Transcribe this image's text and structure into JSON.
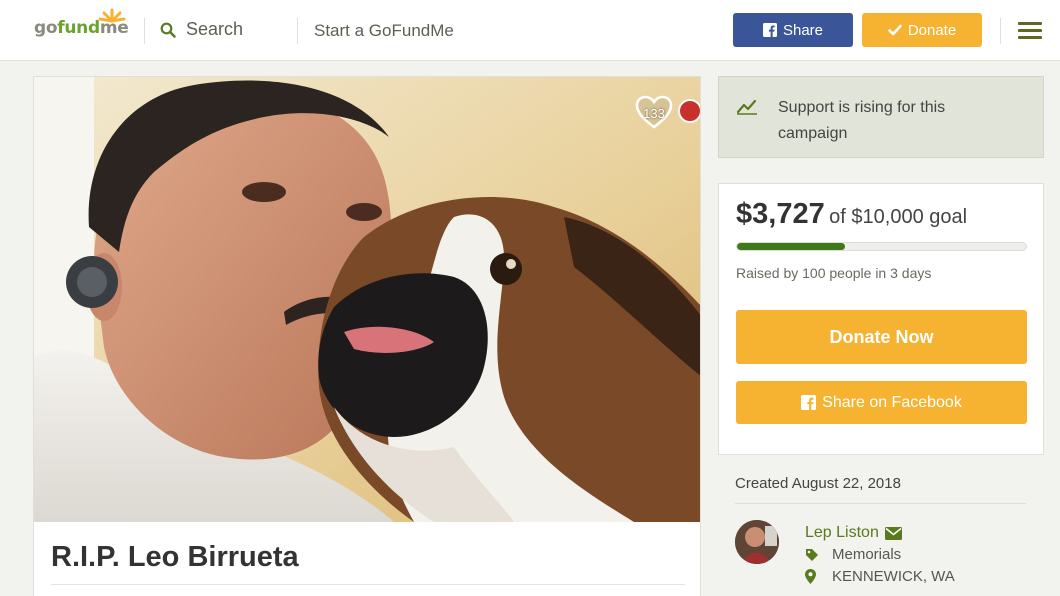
{
  "header": {
    "logo_text": {
      "part1": "go",
      "part2": "fund",
      "part3": "me"
    },
    "search_label": "Search",
    "start_label": "Start a GoFundMe",
    "share_label": "Share",
    "donate_label": "Donate",
    "icons": [
      "search-icon",
      "facebook-icon",
      "check-icon",
      "hamburger-menu-icon"
    ]
  },
  "campaign": {
    "title": "R.I.P. Leo Birrueta",
    "heart_count": "133"
  },
  "rising": {
    "text": "Support is rising for this campaign",
    "icon": "trending-up-icon"
  },
  "progress": {
    "raised": "$3,727",
    "goal_text": "of $10,000 goal",
    "fraction": 0.3727,
    "raised_by": "Raised by 100 people in 3 days",
    "donate_now_label": "Donate Now",
    "share_fb_label": "Share on Facebook"
  },
  "details": {
    "created": "Created August 22, 2018",
    "organizer": "Lep Liston",
    "category": "Memorials",
    "location": "KENNEWICK, WA"
  },
  "colors": {
    "brand_green": "#6ba32f",
    "facebook_blue": "#3a5698",
    "donate_orange": "#f6b332",
    "progress_green": "#3f7a1a",
    "link_green": "#5a7a1e"
  }
}
